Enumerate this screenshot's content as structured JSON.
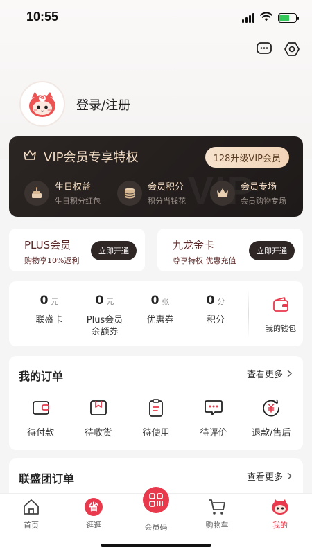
{
  "status_bar": {
    "time": "10:55"
  },
  "top_icons": [
    "message-icon",
    "settings-icon"
  ],
  "profile": {
    "login_label": "登录/注册",
    "avatar_icon": "mascot-avatar-icon"
  },
  "vip": {
    "title": "VIP会员专享特权",
    "upgrade_button": "128升级VIP会员",
    "watermark": "VIP",
    "features": [
      {
        "title": "生日权益",
        "subtitle": "生日积分红包",
        "icon": "cake-icon"
      },
      {
        "title": "会员积分",
        "subtitle": "积分当钱花",
        "icon": "coins-icon"
      },
      {
        "title": "会员专场",
        "subtitle": "会员购物专场",
        "icon": "crown-icon"
      }
    ]
  },
  "plus": {
    "title": "PLUS会员",
    "subtitle": "购物享10%返利",
    "button": "立即开通"
  },
  "jiulong": {
    "title": "九龙金卡",
    "subtitle": "尊享特权 优惠充值",
    "button": "立即开通"
  },
  "wallet": {
    "stats": [
      {
        "value": "0",
        "unit": "元",
        "label": "联盛卡"
      },
      {
        "value": "0",
        "unit": "元",
        "label": "Plus会员余额券"
      },
      {
        "value": "0",
        "unit": "张",
        "label": "优惠券"
      },
      {
        "value": "0",
        "unit": "分",
        "label": "积分"
      }
    ],
    "my_wallet": "我的钱包"
  },
  "orders": {
    "title": "我的订单",
    "see_more": "查看更多",
    "items": [
      {
        "label": "待付款",
        "icon": "wallet-icon"
      },
      {
        "label": "待收货",
        "icon": "package-icon"
      },
      {
        "label": "待使用",
        "icon": "clipboard-icon"
      },
      {
        "label": "待评价",
        "icon": "comment-icon"
      },
      {
        "label": "退款/售后",
        "icon": "refund-icon"
      }
    ]
  },
  "group_orders": {
    "title": "联盛团订单",
    "see_more": "查看更多"
  },
  "tabbar": {
    "items": [
      {
        "label": "首页",
        "icon": "home-icon"
      },
      {
        "label": "逛逛",
        "icon": "save-badge-icon",
        "badge": "省"
      },
      {
        "label": "会员码",
        "icon": "qr-code-icon"
      },
      {
        "label": "购物车",
        "icon": "cart-icon"
      },
      {
        "label": "我的",
        "icon": "mascot-icon"
      }
    ],
    "active": "我的"
  },
  "colors": {
    "accent": "#e8394d",
    "vip_gold": "#f3dcc3",
    "vip_bg": "#221d1c"
  }
}
